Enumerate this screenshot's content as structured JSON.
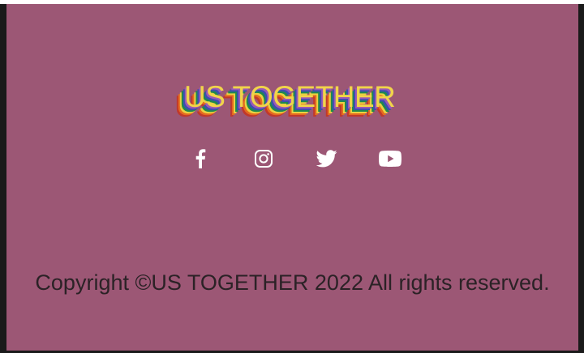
{
  "footer": {
    "brand": "US TOGETHER",
    "brand_color": "#f1d44a",
    "background": "#9c5775",
    "social": [
      {
        "icon": "facebook-icon",
        "label": "Facebook"
      },
      {
        "icon": "instagram-icon",
        "label": "Instagram"
      },
      {
        "icon": "twitter-icon",
        "label": "Twitter"
      },
      {
        "icon": "youtube-icon",
        "label": "YouTube"
      }
    ],
    "copyright": "Copyright ©US TOGETHER 2022 All rights reserved."
  }
}
